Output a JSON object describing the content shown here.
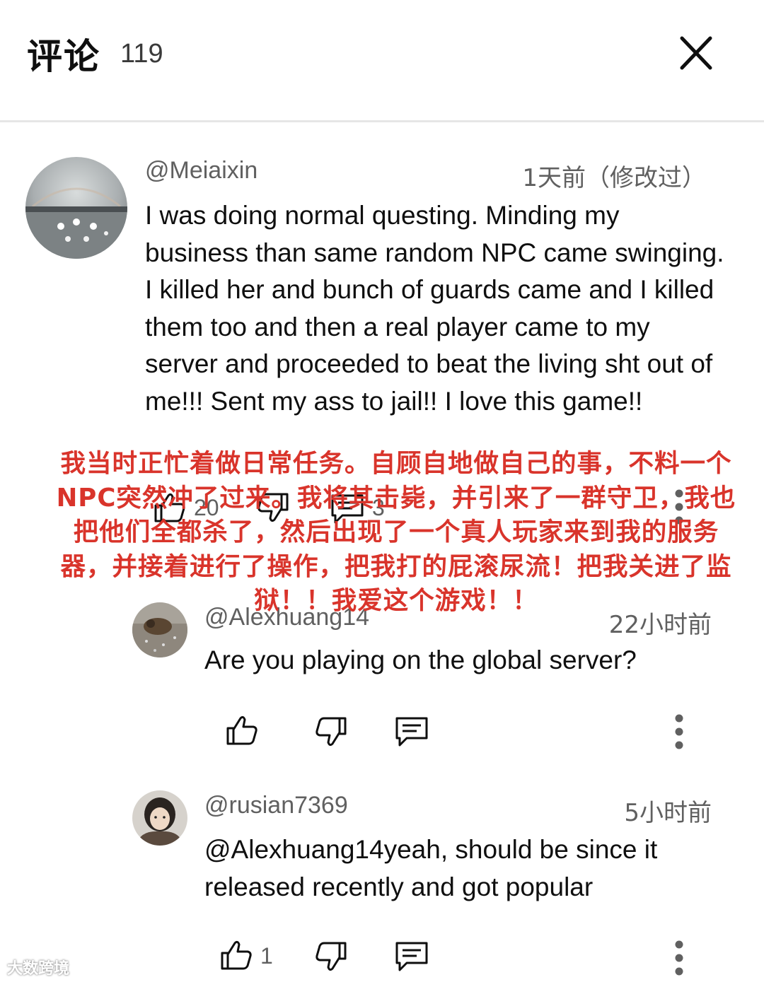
{
  "header": {
    "title": "评论",
    "count": "119"
  },
  "comments": [
    {
      "handle": "@Meiaixin",
      "time": "1天前（修改过）",
      "text": "I was doing normal questing. Minding my business than same random NPC came swinging. I killed her and bunch of guards came and I killed them too and then a real player came to my server and proceeded to beat the living sht out of me!!! Sent my ass to jail!! I love this game!!",
      "likes": "20",
      "replies": "3"
    },
    {
      "handle": "@Alexhuang14",
      "time": "22小时前",
      "text": "Are you playing on the global server?"
    },
    {
      "handle": "@rusian7369",
      "time": "5小时前",
      "text": "@Alexhuang14yeah, should be since it released recently and got popular",
      "likes": "1"
    }
  ],
  "overlay_translation": "我当时正忙着做日常任务。自顾自地做自己的事，不料一个NPC突然冲了过来。我将其击毙，并引来了一群守卫，我也把他们全都杀了，然后出现了一个真人玩家来到我的服务器，并接着进行了操作，把我打的屁滚尿流！把我关进了监狱！！我爱这个游戏！！",
  "watermark": "大数跨境",
  "icons": [
    "close-icon",
    "thumbs-up-icon",
    "thumbs-down-icon",
    "reply-icon",
    "more-vert-icon"
  ],
  "colors": {
    "overlay_text": "#d9342b",
    "secondary_text": "#606060",
    "divider": "#e6e6e6"
  }
}
